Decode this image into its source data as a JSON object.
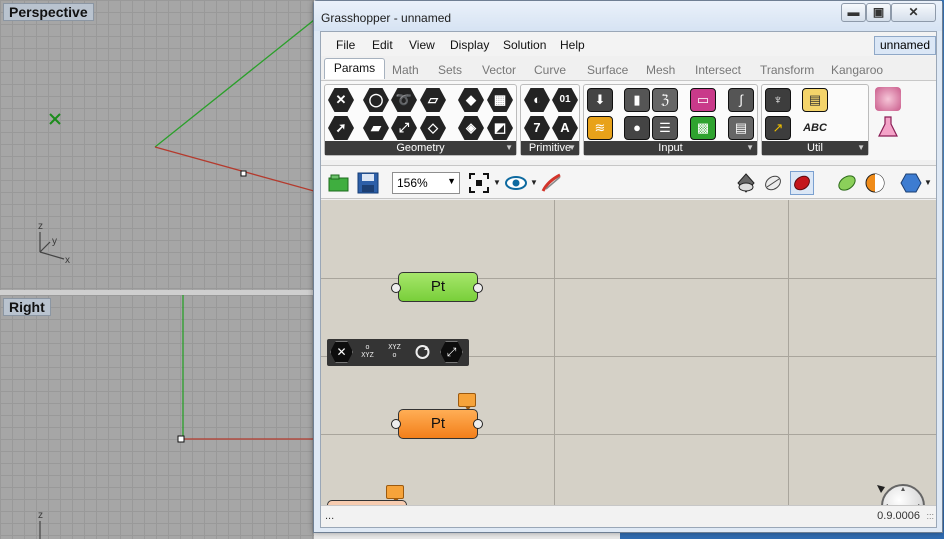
{
  "rhino": {
    "viewports": [
      {
        "label": "Perspective"
      },
      {
        "label": "Right"
      }
    ],
    "axis_labels": {
      "z": "z",
      "y": "y",
      "x": "x"
    }
  },
  "gh": {
    "title": "Grasshopper - unnamed",
    "window_buttons": {
      "minimize": "▬",
      "maximize": "▣",
      "close": "✕"
    },
    "menu": [
      "File",
      "Edit",
      "View",
      "Display",
      "Solution",
      "Help"
    ],
    "document_name": "unnamed",
    "tabs": [
      "Params",
      "Math",
      "Sets",
      "Vector",
      "Curve",
      "Surface",
      "Mesh",
      "Intersect",
      "Transform",
      "Kangaroo"
    ],
    "active_tab": "Params",
    "panels": [
      {
        "name": "Geometry"
      },
      {
        "name": "Primitive"
      },
      {
        "name": "Input"
      },
      {
        "name": "Util"
      }
    ],
    "ribbon_glyphs": {
      "primitive_digits": "01",
      "primitive_seven": "7",
      "primitive_a": "A",
      "util_abc": "ABC"
    },
    "zoom": "156%",
    "components": [
      {
        "label": "Pt",
        "state": "ok",
        "color": "#7fd23f"
      },
      {
        "label": "Pt",
        "state": "warning",
        "color": "#f7861f"
      }
    ],
    "radial_menu": {
      "xyz_top": "o\nXYZ",
      "xyz_bottom": "XYZ\no"
    },
    "status": {
      "left": "...",
      "version": "0.9.0006",
      "grip": ":::"
    },
    "colors": {
      "canvas": "#d5d1c7",
      "ok_component": "#7fd23f",
      "warning_component": "#f7861f",
      "x_axis": "#b83a2e",
      "y_axis": "#2ea32e"
    }
  }
}
